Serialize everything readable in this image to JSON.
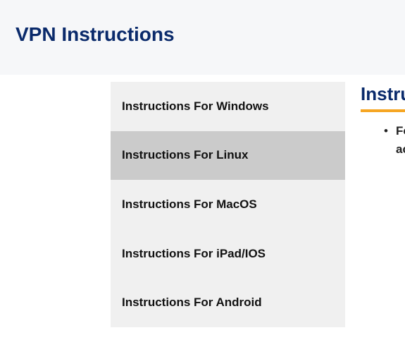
{
  "header": {
    "title": "VPN Instructions"
  },
  "menu": {
    "items": [
      {
        "label": "Instructions For Windows",
        "active": false
      },
      {
        "label": "Instructions For Linux",
        "active": true
      },
      {
        "label": "Instructions For MacOS",
        "active": false
      },
      {
        "label": "Instructions For iPad/IOS",
        "active": false
      },
      {
        "label": "Instructions For Android",
        "active": false
      }
    ]
  },
  "content": {
    "heading": "Instru",
    "bullet_symbol": "•",
    "bullet_line_1": "Fo",
    "bullet_line_2": "ac"
  },
  "colors": {
    "header_bg": "#f6f7f9",
    "title": "#0a2a6b",
    "menu_bg": "#f0f0f0",
    "menu_active_bg": "#cbcbcb",
    "accent_rule": "#f6a623"
  }
}
